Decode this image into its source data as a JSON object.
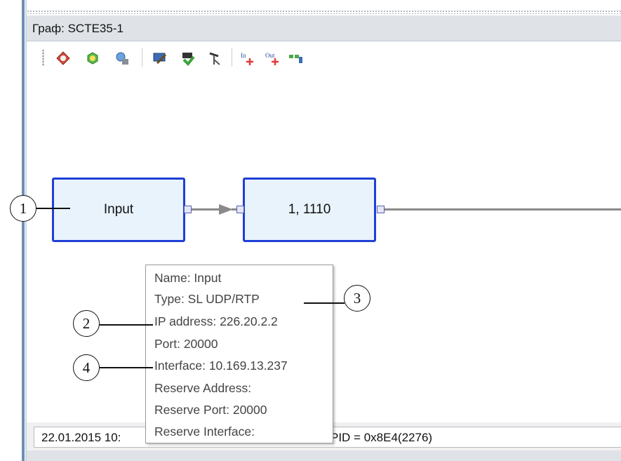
{
  "window": {
    "title": "Граф: SCTE35-1"
  },
  "toolbar": {
    "buttons": [
      {
        "icon": "add-node-icon"
      },
      {
        "icon": "refresh-node-icon"
      },
      {
        "icon": "node-settings-icon"
      },
      {
        "icon": "monitor-edit-icon"
      },
      {
        "icon": "green-arrow-icon"
      },
      {
        "icon": "probe-icon"
      },
      {
        "icon": "add-input-icon"
      },
      {
        "icon": "add-output-icon"
      },
      {
        "icon": "add-block-icon"
      }
    ]
  },
  "graph": {
    "nodes": [
      {
        "label": "Input"
      },
      {
        "label": "1, 1110"
      }
    ]
  },
  "tooltip": {
    "lines": [
      "Name: Input",
      "Type: SL UDP/RTP",
      "IP address: 226.20.2.2",
      "Port: 20000",
      "Interface: 10.169.13.237",
      "Reserve Address:",
      "Reserve Port: 20000",
      "Reserve Interface:"
    ]
  },
  "callouts": [
    "1",
    "2",
    "3",
    "4"
  ],
  "status": {
    "left": "22.01.2015 10:",
    "right": "PID = 0x8E4(2276)"
  },
  "colors": {
    "node_border": "#1f3fd6",
    "node_fill": "#e8f3fc",
    "connector": "#8a8a8a",
    "frame": "#6e8fb4"
  }
}
